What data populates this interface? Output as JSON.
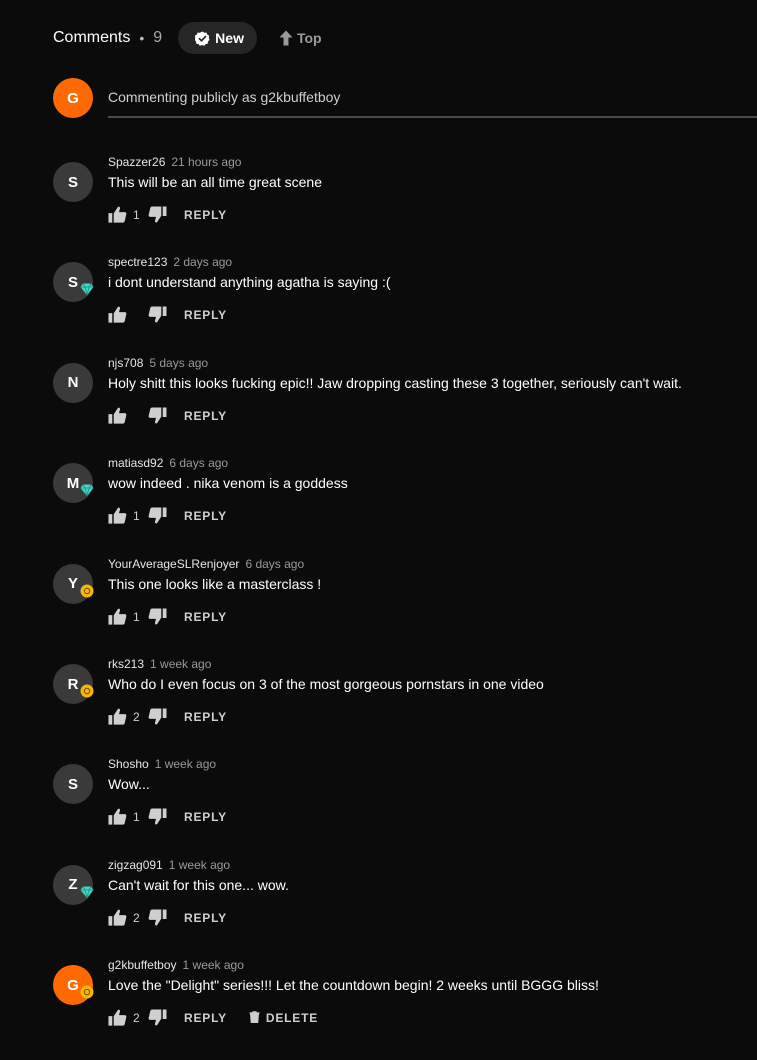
{
  "header": {
    "title": "Comments",
    "separator": "•",
    "count": "9",
    "sort_new": "New",
    "sort_top": "Top"
  },
  "composer": {
    "avatar_letter": "G",
    "placeholder": "Commenting publicly as g2kbuffetboy"
  },
  "actions": {
    "reply_label": "REPLY",
    "delete_label": "DELETE"
  },
  "colors": {
    "background": "#0b0b0b",
    "accent": "#ff6a00",
    "avatar_grey": "#3a3a3a",
    "diamond": "#40d8c6",
    "sun": "#f5b800"
  },
  "comments": [
    {
      "avatar": "S",
      "user": "Spazzer26",
      "time": "21 hours ago",
      "text": "This will be an all time great scene",
      "likes": "1",
      "badge": "none"
    },
    {
      "avatar": "S",
      "user": "spectre123",
      "time": "2 days ago",
      "text": "i dont understand anything agatha is saying :(",
      "likes": "",
      "badge": "diamond-icon"
    },
    {
      "avatar": "N",
      "user": "njs708",
      "time": "5 days ago",
      "text": "Holy shitt this looks fucking epic!! Jaw dropping casting these 3 together, seriously can't wait.",
      "likes": "",
      "badge": "none"
    },
    {
      "avatar": "M",
      "user": "matiasd92",
      "time": "6 days ago",
      "text": "wow indeed . nika venom is a goddess",
      "likes": "1",
      "badge": "diamond-icon"
    },
    {
      "avatar": "Y",
      "user": "YourAverageSLRenjoyer",
      "time": "6 days ago",
      "text": "This one looks like a masterclass !",
      "likes": "1",
      "badge": "sun-icon"
    },
    {
      "avatar": "R",
      "user": "rks213",
      "time": "1 week ago",
      "text": "Who do I even focus on 3 of the most gorgeous pornstars in one video",
      "likes": "2",
      "badge": "sun-icon"
    },
    {
      "avatar": "S",
      "user": "Shosho",
      "time": "1 week ago",
      "text": "Wow...",
      "likes": "1",
      "badge": "none"
    },
    {
      "avatar": "Z",
      "user": "zigzag091",
      "time": "1 week ago",
      "text": "Can't wait for this one... wow.",
      "likes": "2",
      "badge": "diamond-icon"
    },
    {
      "avatar": "G",
      "user": "g2kbuffetboy",
      "time": "1 week ago",
      "text": "Love the \"Delight\" series!!! Let the countdown begin! 2 weeks until BGGG bliss!",
      "likes": "2",
      "badge": "sun-icon",
      "own": true
    }
  ]
}
